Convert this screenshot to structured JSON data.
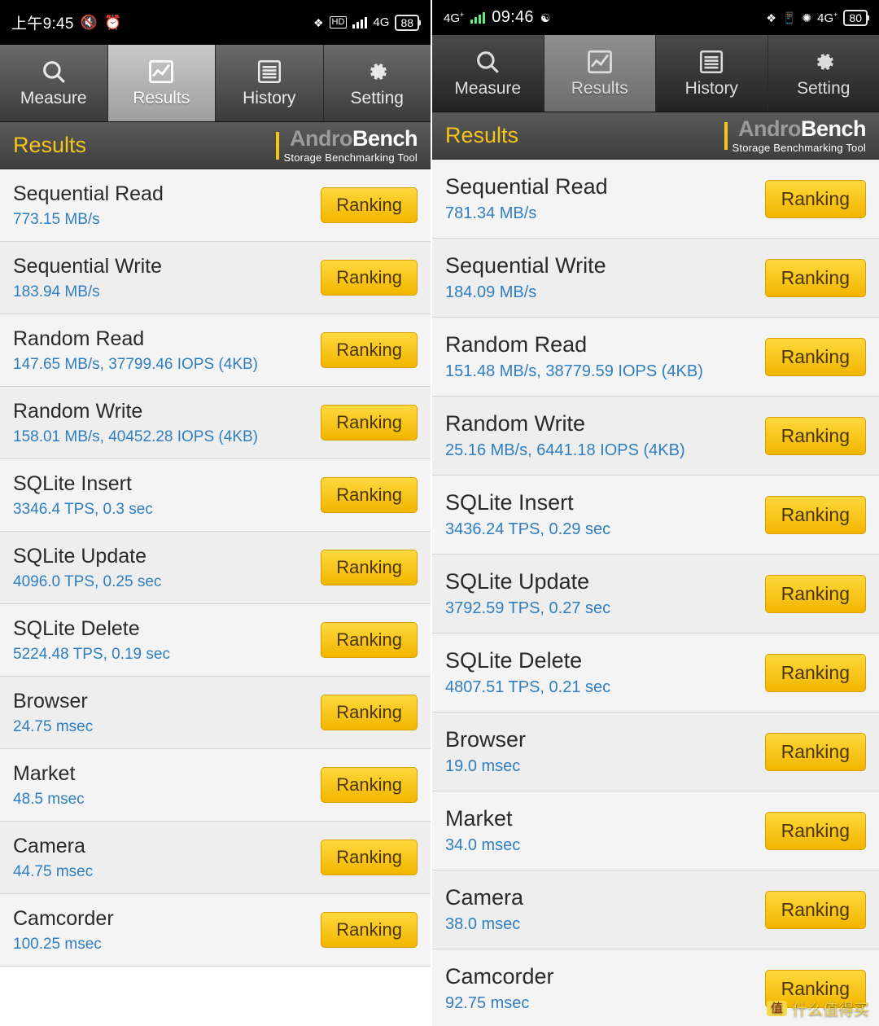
{
  "app": {
    "title": "Results",
    "brand_name_grey": "Andro",
    "brand_name_white": "Bench",
    "brand_tagline": "Storage Benchmarking Tool",
    "accent_yellow": "#f5c518",
    "value_blue": "#2f7ec2"
  },
  "tabs": [
    {
      "label": "Measure",
      "icon": "search-icon",
      "active": false
    },
    {
      "label": "Results",
      "icon": "chart-icon",
      "active": true
    },
    {
      "label": "History",
      "icon": "list-icon",
      "active": false
    },
    {
      "label": "Setting",
      "icon": "gear-icon",
      "active": false
    }
  ],
  "left": {
    "statusbar": {
      "time": "上午9:45",
      "icons_left": [
        "mute-icon",
        "alarm-icon"
      ],
      "icons_right": [
        "bluetooth-icon",
        "hd-voice-icon",
        "signal-icon"
      ],
      "network": "4G",
      "battery": "88"
    },
    "rank_label": "Ranking",
    "rows": [
      {
        "name": "Sequential Read",
        "value": "773.15 MB/s"
      },
      {
        "name": "Sequential Write",
        "value": "183.94 MB/s"
      },
      {
        "name": "Random Read",
        "value": "147.65 MB/s, 37799.46 IOPS (4KB)"
      },
      {
        "name": "Random Write",
        "value": "158.01 MB/s, 40452.28 IOPS (4KB)"
      },
      {
        "name": "SQLite Insert",
        "value": "3346.4 TPS, 0.3 sec"
      },
      {
        "name": "SQLite Update",
        "value": "4096.0 TPS, 0.25 sec"
      },
      {
        "name": "SQLite Delete",
        "value": "5224.48 TPS, 0.19 sec"
      },
      {
        "name": "Browser",
        "value": "24.75 msec"
      },
      {
        "name": "Market",
        "value": "48.5 msec"
      },
      {
        "name": "Camera",
        "value": "44.75 msec"
      },
      {
        "name": "Camcorder",
        "value": "100.25 msec"
      }
    ]
  },
  "right": {
    "statusbar": {
      "time": "09:46",
      "network_left": "4G",
      "icons_left": [
        "signal-icon",
        "wechat-icon"
      ],
      "icons_right": [
        "bluetooth-icon",
        "vibrate-icon",
        "wifi-icon"
      ],
      "network": "4G",
      "battery": "80"
    },
    "rank_label": "Ranking",
    "rows": [
      {
        "name": "Sequential Read",
        "value": "781.34 MB/s"
      },
      {
        "name": "Sequential Write",
        "value": "184.09 MB/s"
      },
      {
        "name": "Random Read",
        "value": "151.48 MB/s, 38779.59 IOPS (4KB)"
      },
      {
        "name": "Random Write",
        "value": "25.16 MB/s, 6441.18 IOPS (4KB)"
      },
      {
        "name": "SQLite Insert",
        "value": "3436.24 TPS, 0.29 sec"
      },
      {
        "name": "SQLite Update",
        "value": "3792.59 TPS, 0.27 sec"
      },
      {
        "name": "SQLite Delete",
        "value": "4807.51 TPS, 0.21 sec"
      },
      {
        "name": "Browser",
        "value": "19.0 msec"
      },
      {
        "name": "Market",
        "value": "34.0 msec"
      },
      {
        "name": "Camera",
        "value": "38.0 msec"
      },
      {
        "name": "Camcorder",
        "value": "92.75 msec"
      }
    ]
  },
  "watermark": {
    "badge": "值",
    "text": "什么值得买"
  }
}
